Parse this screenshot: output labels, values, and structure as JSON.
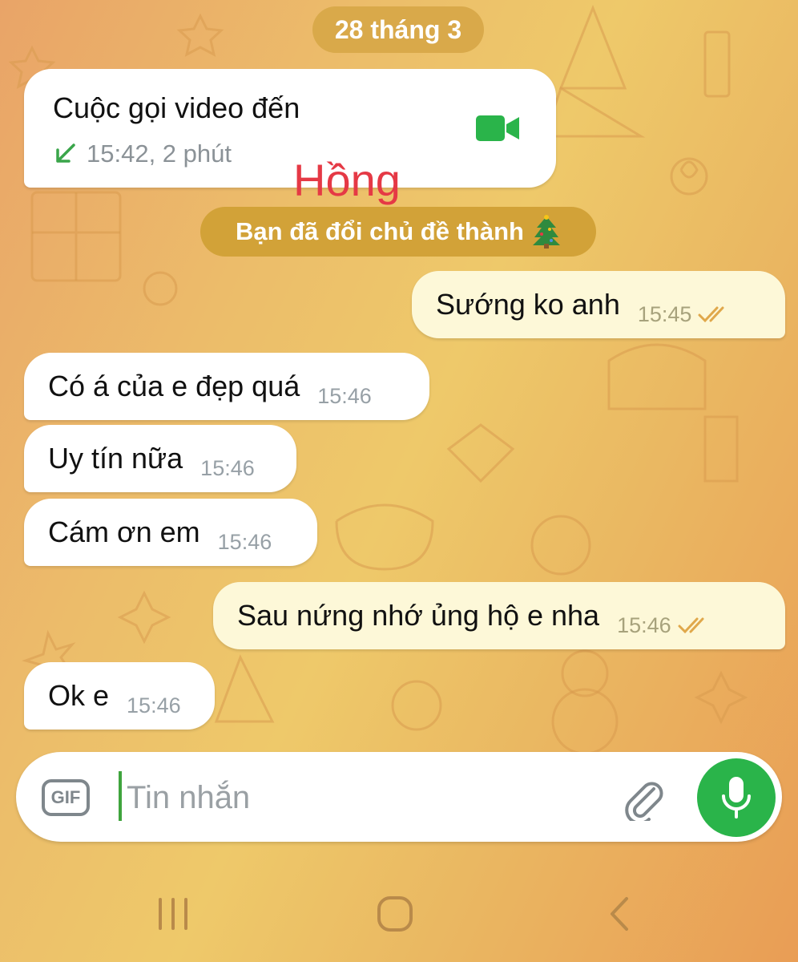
{
  "date_header": "28 tháng 3",
  "call": {
    "title": "Cuộc gọi video đến",
    "meta": "15:42, 2 phút",
    "direction_icon": "incoming-arrow-icon",
    "type_icon": "video-camera-icon"
  },
  "overlay_name": "Hồng",
  "theme_notice": {
    "text": "Bạn đã đổi chủ đề thành",
    "emoji": "christmas-tree-icon"
  },
  "messages": [
    {
      "text": "Sướng ko anh",
      "time": "15:45",
      "direction": "out",
      "status": "read"
    },
    {
      "text": "Có á của e đẹp quá",
      "time": "15:46",
      "direction": "in"
    },
    {
      "text": "Uy tín nữa",
      "time": "15:46",
      "direction": "in"
    },
    {
      "text": "Cám ơn em",
      "time": "15:46",
      "direction": "in"
    },
    {
      "text": "Sau nứng nhớ ủng hộ e nha",
      "time": "15:46",
      "direction": "out",
      "status": "read"
    },
    {
      "text": "Ok e",
      "time": "15:46",
      "direction": "in"
    }
  ],
  "composer": {
    "placeholder": "Tin nhắn",
    "gif_label": "GIF",
    "attach_icon": "paperclip-icon",
    "send_icon": "microphone-icon"
  },
  "nav_icons": [
    "recent-apps-icon",
    "home-icon",
    "back-icon"
  ],
  "colors": {
    "accent_green": "#2ab44a",
    "overlay_name": "#e53945",
    "tick_read": "#e0a84b"
  }
}
